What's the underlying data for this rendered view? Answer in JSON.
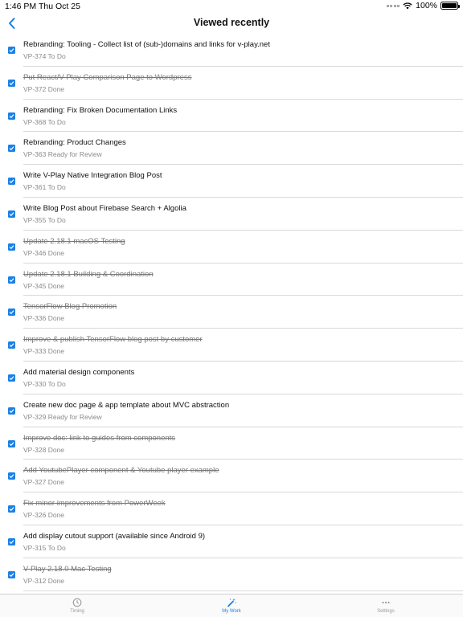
{
  "statusbar": {
    "time": "1:46 PM",
    "date": "Thu Oct 25",
    "battery": "100%"
  },
  "header": {
    "title": "Viewed recently",
    "back_icon": "chevron-left-icon"
  },
  "items": [
    {
      "title": "Rebranding: Tooling - Collect list of (sub-)domains and links for v-play.net",
      "subtitle": "VP-374 To Do",
      "done": false
    },
    {
      "title": "Put React/V-Play Comparison Page to Wordpress",
      "subtitle": "VP-372 Done",
      "done": true
    },
    {
      "title": "Rebranding: Fix Broken Documentation Links",
      "subtitle": "VP-368 To Do",
      "done": false
    },
    {
      "title": "Rebranding: Product Changes",
      "subtitle": "VP-363 Ready for Review",
      "done": false
    },
    {
      "title": "Write V-Play Native Integration Blog Post",
      "subtitle": "VP-361 To Do",
      "done": false
    },
    {
      "title": "Write Blog Post about Firebase Search + Algolia",
      "subtitle": "VP-355 To Do",
      "done": false
    },
    {
      "title": "Update 2.18.1 macOS Testing",
      "subtitle": "VP-346 Done",
      "done": true
    },
    {
      "title": "Update 2.18.1 Building & Coordination",
      "subtitle": "VP-345 Done",
      "done": true
    },
    {
      "title": "TensorFlow Blog Promotion",
      "subtitle": "VP-336 Done",
      "done": true
    },
    {
      "title": "Improve & publish TensorFlow blog post by customer",
      "subtitle": "VP-333 Done",
      "done": true
    },
    {
      "title": "Add material design components",
      "subtitle": "VP-330 To Do",
      "done": false
    },
    {
      "title": "Create new doc page & app template about MVC abstraction",
      "subtitle": "VP-329 Ready for Review",
      "done": false
    },
    {
      "title": "Improve doc: link to guides from components",
      "subtitle": "VP-328 Done",
      "done": true
    },
    {
      "title": "Add YoutubePlayer component & Youtube player example",
      "subtitle": "VP-327 Done",
      "done": true
    },
    {
      "title": "Fix minor improvements from PowerWeek",
      "subtitle": "VP-326 Done",
      "done": true
    },
    {
      "title": "Add display cutout support (available since Android 9)",
      "subtitle": "VP-315 To Do",
      "done": false
    },
    {
      "title": "V-Play 2.18.0 Mac Testing",
      "subtitle": "VP-312 Done",
      "done": true
    }
  ],
  "tabs": [
    {
      "label": "Timing",
      "icon": "clock-icon",
      "active": false
    },
    {
      "label": "My Work",
      "icon": "magic-wand-icon",
      "active": true
    },
    {
      "label": "Settings",
      "icon": "more-dots-icon",
      "active": false
    }
  ],
  "colors": {
    "accent": "#1a80e6",
    "divider": "#d9d9d9",
    "muted": "#8a8a8a"
  }
}
